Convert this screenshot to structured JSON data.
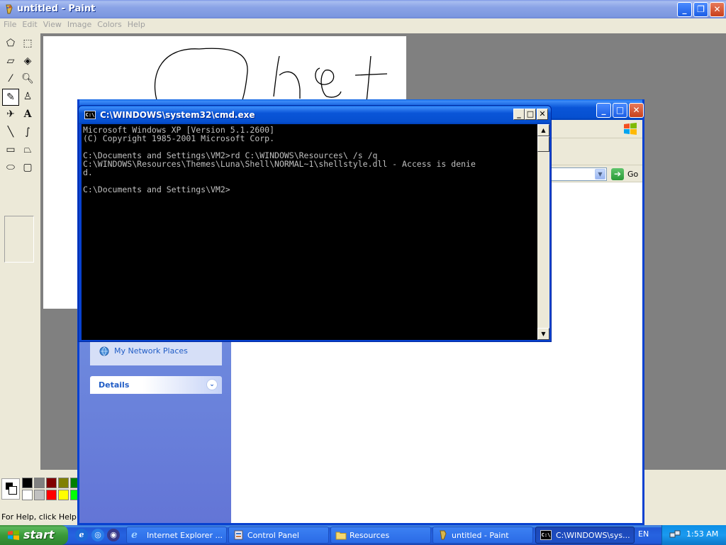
{
  "paint": {
    "title": "untitled - Paint",
    "menu": [
      "File",
      "Edit",
      "View",
      "Image",
      "Colors",
      "Help"
    ],
    "status": "For Help, click Help Topics on the Help Menu.",
    "palette": [
      "#000000",
      "#808080",
      "#800000",
      "#808000",
      "#008000",
      "#ffffff",
      "#c0c0c0",
      "#ff0000",
      "#ffff00",
      "#00ff00"
    ]
  },
  "explorer": {
    "go_label": "Go",
    "network_places": "My Network Places",
    "details": "Details"
  },
  "cmd": {
    "title": "C:\\WINDOWS\\system32\\cmd.exe",
    "lines": [
      "Microsoft Windows XP [Version 5.1.2600]",
      "(C) Copyright 1985-2001 Microsoft Corp.",
      "",
      "C:\\Documents and Settings\\VM2>rd C:\\WINDOWS\\Resources\\ /s /q",
      "C:\\WINDOWS\\Resources\\Themes\\Luna\\Shell\\NORMAL~1\\shellstyle.dll - Access is denie",
      "d.",
      "",
      "C:\\Documents and Settings\\VM2>"
    ]
  },
  "taskbar": {
    "start": "start",
    "tasks": [
      {
        "label": "Internet Explorer ...",
        "icon": "ie-icon"
      },
      {
        "label": "Control Panel",
        "icon": "control-panel-icon"
      },
      {
        "label": "Resources",
        "icon": "folder-icon"
      },
      {
        "label": "untitled - Paint",
        "icon": "paint-icon"
      },
      {
        "label": "C:\\WINDOWS\\sys...",
        "icon": "cmd-icon"
      }
    ],
    "language": "EN",
    "clock": "1:53 AM"
  }
}
